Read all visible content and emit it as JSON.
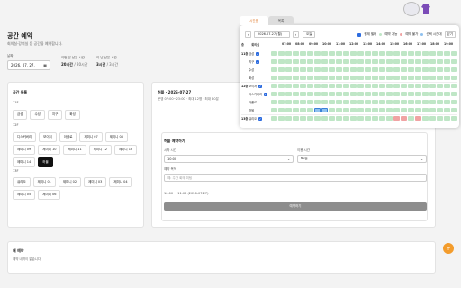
{
  "app": {
    "title": "공간 예약",
    "subtitle": "회의실·강의실 등 공간을 예약합니다."
  },
  "date_field": {
    "label": "날짜",
    "value": "2026. 07. 27."
  },
  "stats": [
    {
      "label": "이번 달 남은 시간",
      "value": "20시간",
      "suffix": "/ 20시간"
    },
    {
      "label": "이 날 남은 시간",
      "value": "3시간",
      "suffix": "/ 3시간"
    }
  ],
  "spaces_card": {
    "title": "공간 목록",
    "floors": [
      {
        "label": "11F",
        "chips": [
          {
            "label": "금성",
            "active": false
          },
          {
            "label": "수성",
            "active": false
          },
          {
            "label": "지구",
            "active": false
          },
          {
            "label": "화성",
            "active": false
          }
        ]
      },
      {
        "label": "12F",
        "chips": [
          {
            "label": "디스커버리",
            "active": false
          },
          {
            "label": "보이저",
            "active": false
          },
          {
            "label": "아폴로",
            "active": false
          },
          {
            "label": "제미니 07",
            "active": false
          },
          {
            "label": "제미니 08",
            "active": false
          },
          {
            "label": "제미니 09",
            "active": false
          },
          {
            "label": "제미니 10",
            "active": false
          },
          {
            "label": "제미니 11",
            "active": false
          },
          {
            "label": "제미니 12",
            "active": false
          },
          {
            "label": "제미니 13",
            "active": false
          },
          {
            "label": "제미니 14",
            "active": false
          },
          {
            "label": "허블",
            "active": true
          }
        ]
      },
      {
        "label": "13F",
        "chips": [
          {
            "label": "큐리오",
            "active": false
          },
          {
            "label": "제미니 01",
            "active": false
          },
          {
            "label": "제미니 02",
            "active": false
          },
          {
            "label": "제미니 03",
            "active": false
          },
          {
            "label": "제미니 04",
            "active": false
          },
          {
            "label": "제미니 05",
            "active": false
          },
          {
            "label": "제미니 06",
            "active": false
          }
        ]
      }
    ]
  },
  "booking_card": {
    "heading": "허블 · 2026-07-27",
    "sub": "운영 07:00~23:00 · 최대 12명 · 최대 60분",
    "form_title": "허블 예약하기",
    "start_label": "시작 시간",
    "start_value": "10:00",
    "duration_label": "이용 시간",
    "duration_value": "60분",
    "purpose_label": "예약 목적",
    "purpose_placeholder": "예: 주간 회의 미팅",
    "summary": "10:00 ~ 11:00 (2026-07-27)",
    "submit_label": "예약하기"
  },
  "my_card": {
    "title": "내 예약",
    "empty": "예약 내역이 없습니다."
  },
  "fab_icon": "plus-icon",
  "grid_panel": {
    "tabs": [
      "시간표",
      "목록"
    ],
    "date": "2026.07.27 (월)",
    "today_label": "오늘",
    "toggle_label": "현재 필터",
    "legend": [
      "예약 가능",
      "예약 불가",
      "선택 시간대"
    ],
    "close_label": "닫기",
    "header_floor": "층",
    "header_space": "회의실",
    "hours": [
      "07:00",
      "08:00",
      "09:00",
      "10:00",
      "11:00",
      "12:00",
      "13:00",
      "14:00",
      "15:00",
      "16:00",
      "17:00",
      "18:00",
      "19:00"
    ],
    "colors": {
      "available": "#bfe6c6",
      "booked": "#f0a3a3",
      "selected": "#8fc1ef",
      "accent": "#e07b2e"
    },
    "rows": [
      {
        "floor": "11층",
        "space": "금성",
        "badge": true,
        "booked": [],
        "selected": []
      },
      {
        "floor": "",
        "space": "지구",
        "badge": true,
        "booked": [],
        "selected": []
      },
      {
        "floor": "",
        "space": "수성",
        "badge": false,
        "booked": [],
        "selected": []
      },
      {
        "floor": "",
        "space": "화성",
        "badge": false,
        "booked": [],
        "selected": []
      },
      {
        "floor": "12층",
        "space": "보이저",
        "badge": true,
        "booked": [],
        "selected": []
      },
      {
        "floor": "",
        "space": "디스커버리",
        "badge": true,
        "booked": [],
        "selected": []
      },
      {
        "floor": "",
        "space": "아폴로",
        "badge": false,
        "booked": [],
        "selected": []
      },
      {
        "floor": "",
        "space": "허블",
        "badge": false,
        "booked": [],
        "selected": [
          6,
          7
        ]
      },
      {
        "floor": "13층",
        "space": "큐리오",
        "badge": true,
        "booked": [
          17,
          18,
          20
        ],
        "selected": []
      }
    ]
  }
}
